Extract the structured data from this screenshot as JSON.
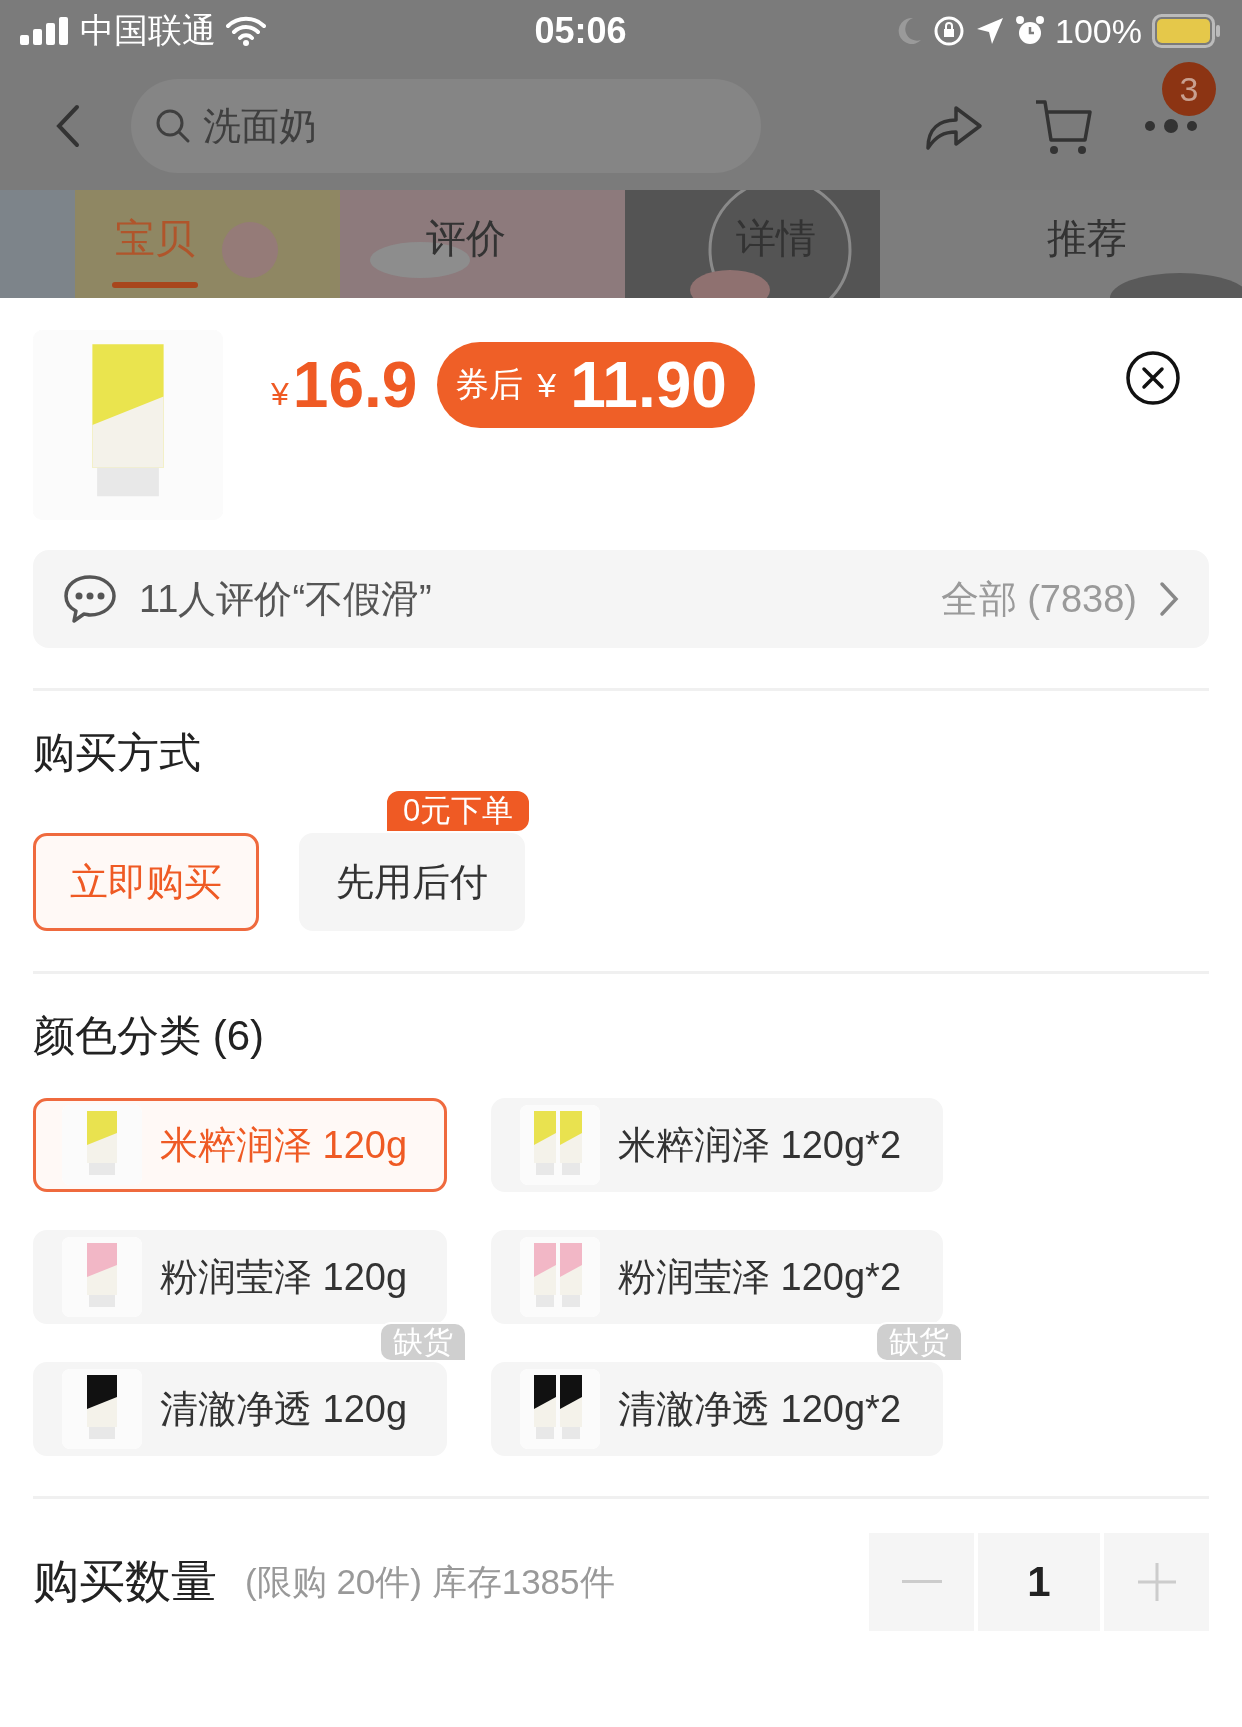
{
  "status_bar": {
    "carrier": "中国联通",
    "time": "05:06",
    "battery": "100%"
  },
  "nav": {
    "search": {
      "value": "洗面奶"
    },
    "badge": "3"
  },
  "tabs": [
    {
      "label": "宝贝",
      "selected": true
    },
    {
      "label": "评价",
      "selected": false
    },
    {
      "label": "详情",
      "selected": false
    },
    {
      "label": "推荐",
      "selected": false
    }
  ],
  "product": {
    "currency": "¥",
    "price": "16.9",
    "coupon": {
      "label": "券后",
      "currency": "¥",
      "price": "11.90"
    }
  },
  "review_bar": {
    "summary": "11人评价“不假滑”",
    "all": "全部 (7838)"
  },
  "purchase_method": {
    "title": "购买方式",
    "options": [
      {
        "label": "立即购买",
        "selected": true
      },
      {
        "label": "先用后付",
        "selected": false,
        "badge": "0元下单"
      }
    ]
  },
  "variants": {
    "title": "颜色分类 (6)",
    "options": [
      {
        "label": "米粹润泽 120g",
        "selected": true
      },
      {
        "label": "米粹润泽 120g*2",
        "selected": false
      },
      {
        "label": "粉润莹泽 120g",
        "selected": false
      },
      {
        "label": "粉润莹泽 120g*2",
        "selected": false
      },
      {
        "label": "清澈净透 120g",
        "selected": false,
        "badge": "缺货"
      },
      {
        "label": "清澈净透 120g*2",
        "selected": false,
        "badge": "缺货"
      }
    ]
  },
  "quantity": {
    "title": "购买数量",
    "note": "(限购 20件) 库存1385件",
    "value": "1"
  }
}
